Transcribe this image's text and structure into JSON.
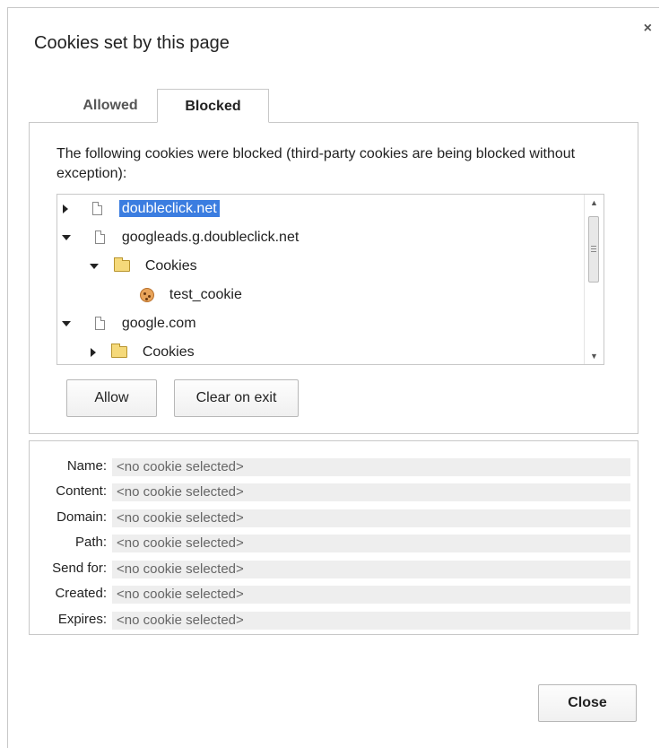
{
  "dialog": {
    "title": "Cookies set by this page",
    "close_glyph": "×"
  },
  "tabs": [
    {
      "label": "Allowed",
      "active": false
    },
    {
      "label": "Blocked",
      "active": true
    }
  ],
  "panel": {
    "description": "The following cookies were blocked (third-party cookies are being blocked without exception):"
  },
  "tree": {
    "items": [
      {
        "label": "doubleclick.net",
        "expanded": false,
        "icon": "file-icon",
        "selected": true
      },
      {
        "label": "googleads.g.doubleclick.net",
        "expanded": true,
        "icon": "file-icon"
      },
      {
        "label": "Cookies",
        "expanded": true,
        "icon": "folder-icon"
      },
      {
        "label": "test_cookie",
        "icon": "cookie-icon"
      },
      {
        "label": "google.com",
        "expanded": true,
        "icon": "file-icon"
      },
      {
        "label": "Cookies",
        "expanded": false,
        "icon": "folder-icon"
      }
    ]
  },
  "buttons": {
    "allow": "Allow",
    "clear_on_exit": "Clear on exit",
    "close": "Close"
  },
  "details": {
    "rows": [
      {
        "label": "Name:",
        "value": "<no cookie selected>"
      },
      {
        "label": "Content:",
        "value": "<no cookie selected>"
      },
      {
        "label": "Domain:",
        "value": "<no cookie selected>"
      },
      {
        "label": "Path:",
        "value": "<no cookie selected>"
      },
      {
        "label": "Send for:",
        "value": "<no cookie selected>"
      },
      {
        "label": "Created:",
        "value": "<no cookie selected>"
      },
      {
        "label": "Expires:",
        "value": "<no cookie selected>"
      }
    ]
  },
  "colors": {
    "selection": "#3b7de0",
    "border": "#c8c8c8",
    "value_bg": "#eeeeee"
  }
}
